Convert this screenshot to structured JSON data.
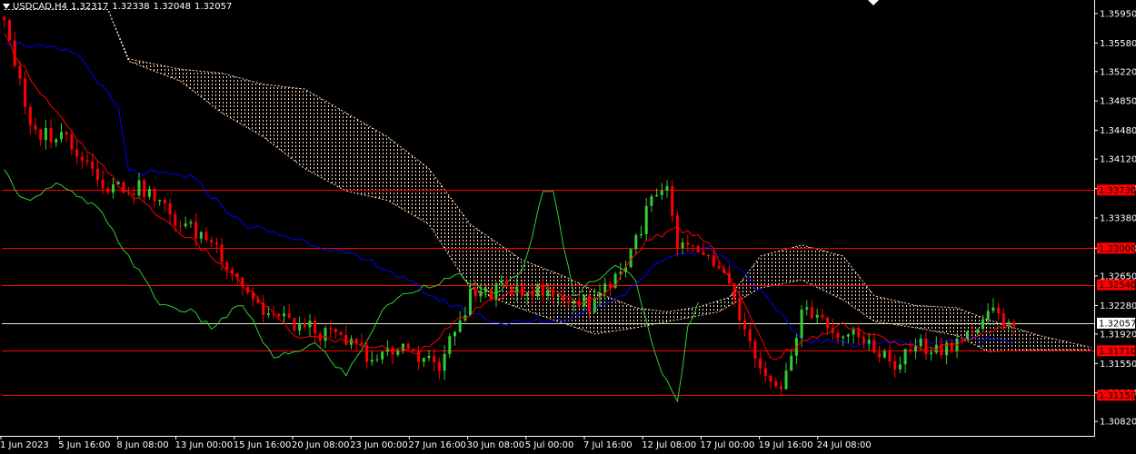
{
  "header": {
    "symbol": "USDCAD,H4",
    "open": "1.32317",
    "high": "1.32338",
    "low": "1.32048",
    "close": "1.32057"
  },
  "colors": {
    "background": "#000000",
    "axis": "#ffffff",
    "bull": "#32cd32",
    "bear": "#ff0000",
    "tenkan": "#ff0000",
    "kijun": "#0000ff",
    "chikou": "#32cd32",
    "cloud": "#ffdab9",
    "hline": "#ff0000",
    "current_price_line": "#e8e8d0"
  },
  "chart_data": {
    "type": "candlestick",
    "symbol": "USDCAD",
    "timeframe": "H4",
    "ylim": [
      1.3064,
      1.3612
    ],
    "y_ticks": [
      "1.35950",
      "1.35580",
      "1.35220",
      "1.34850",
      "1.34480",
      "1.34120",
      "1.33750",
      "1.33380",
      "1.33000",
      "1.32650",
      "1.32280",
      "1.31920",
      "1.31550",
      "1.31180",
      "1.30820"
    ],
    "x_ticks": [
      "1 Jun 2023",
      "5 Jun 16:00",
      "8 Jun 08:00",
      "13 Jun 00:00",
      "15 Jun 16:00",
      "20 Jun 08:00",
      "23 Jun 00:00",
      "27 Jun 16:00",
      "30 Jun 08:00",
      "5 Jul 00:00",
      "7 Jul 16:00",
      "12 Jul 08:00",
      "17 Jul 00:00",
      "19 Jul 16:00",
      "24 Jul 08:00"
    ],
    "horizontal_levels": [
      {
        "label": "1.33730",
        "value": 1.3373
      },
      {
        "label": "1.33000",
        "value": 1.33
      },
      {
        "label": "1.32540",
        "value": 1.3254
      },
      {
        "label": "1.31710",
        "value": 1.3171
      },
      {
        "label": "1.31150",
        "value": 1.3115
      }
    ],
    "current_price": {
      "label": "1.32057",
      "value": 1.32057
    },
    "close_path": [
      [
        0,
        1.3592
      ],
      [
        5,
        1.3446
      ],
      [
        12,
        1.344
      ],
      [
        20,
        1.3378
      ],
      [
        27,
        1.3374
      ],
      [
        34,
        1.333
      ],
      [
        40,
        1.331
      ],
      [
        50,
        1.322
      ],
      [
        58,
        1.32
      ],
      [
        66,
        1.3182
      ],
      [
        72,
        1.316
      ],
      [
        78,
        1.3176
      ],
      [
        84,
        1.315
      ],
      [
        90,
        1.324
      ],
      [
        99,
        1.3252
      ],
      [
        106,
        1.324
      ],
      [
        113,
        1.323
      ],
      [
        120,
        1.328
      ],
      [
        125,
        1.336
      ],
      [
        128,
        1.3372
      ],
      [
        130,
        1.3298
      ],
      [
        135,
        1.3294
      ],
      [
        140,
        1.325
      ],
      [
        146,
        1.314
      ],
      [
        150,
        1.3112
      ],
      [
        154,
        1.3226
      ],
      [
        160,
        1.3196
      ],
      [
        167,
        1.3182
      ],
      [
        172,
        1.315
      ],
      [
        176,
        1.318
      ],
      [
        180,
        1.3172
      ],
      [
        186,
        1.319
      ],
      [
        191,
        1.3218
      ],
      [
        195,
        1.32057
      ]
    ],
    "tenkan_path": [
      [
        0,
        1.3566
      ],
      [
        6,
        1.3505
      ],
      [
        14,
        1.3436
      ],
      [
        22,
        1.338
      ],
      [
        30,
        1.334
      ],
      [
        40,
        1.329
      ],
      [
        50,
        1.323
      ],
      [
        56,
        1.319
      ],
      [
        64,
        1.3185
      ],
      [
        72,
        1.3175
      ],
      [
        80,
        1.317
      ],
      [
        88,
        1.321
      ],
      [
        96,
        1.324
      ],
      [
        104,
        1.325
      ],
      [
        112,
        1.323
      ],
      [
        118,
        1.3255
      ],
      [
        124,
        1.331
      ],
      [
        130,
        1.3325
      ],
      [
        136,
        1.331
      ],
      [
        142,
        1.324
      ],
      [
        148,
        1.316
      ],
      [
        154,
        1.318
      ],
      [
        162,
        1.3205
      ],
      [
        170,
        1.3185
      ],
      [
        178,
        1.3172
      ],
      [
        186,
        1.3185
      ],
      [
        195,
        1.3205
      ]
    ],
    "kijun_path": [
      [
        0,
        1.356
      ],
      [
        14,
        1.3545
      ],
      [
        22,
        1.3475
      ],
      [
        24,
        1.3396
      ],
      [
        36,
        1.339
      ],
      [
        46,
        1.333
      ],
      [
        60,
        1.3305
      ],
      [
        72,
        1.328
      ],
      [
        84,
        1.3235
      ],
      [
        96,
        1.3205
      ],
      [
        108,
        1.321
      ],
      [
        114,
        1.3225
      ],
      [
        120,
        1.3245
      ],
      [
        128,
        1.329
      ],
      [
        136,
        1.33
      ],
      [
        142,
        1.3275
      ],
      [
        148,
        1.323
      ],
      [
        154,
        1.3185
      ],
      [
        164,
        1.318
      ],
      [
        176,
        1.3182
      ],
      [
        186,
        1.3185
      ],
      [
        195,
        1.3186
      ]
    ],
    "chikou_path": [
      [
        0,
        1.3395
      ],
      [
        4,
        1.336
      ],
      [
        10,
        1.338
      ],
      [
        18,
        1.335
      ],
      [
        24,
        1.329
      ],
      [
        30,
        1.323
      ],
      [
        36,
        1.322
      ],
      [
        40,
        1.32
      ],
      [
        46,
        1.323
      ],
      [
        52,
        1.316
      ],
      [
        60,
        1.318
      ],
      [
        66,
        1.314
      ],
      [
        74,
        1.323
      ],
      [
        80,
        1.325
      ],
      [
        88,
        1.3265
      ],
      [
        94,
        1.324
      ],
      [
        100,
        1.327
      ],
      [
        104,
        1.3368
      ],
      [
        106,
        1.337
      ],
      [
        110,
        1.324
      ],
      [
        114,
        1.326
      ],
      [
        118,
        1.328
      ],
      [
        122,
        1.3258
      ],
      [
        126,
        1.316
      ],
      [
        130,
        1.3105
      ],
      [
        132,
        1.32
      ],
      [
        134,
        1.323
      ]
    ],
    "cloud_span_a": [
      [
        0,
        1.36
      ],
      [
        20,
        1.36
      ],
      [
        24,
        1.3538
      ],
      [
        34,
        1.3525
      ],
      [
        42,
        1.352
      ],
      [
        50,
        1.3506
      ],
      [
        58,
        1.35
      ],
      [
        66,
        1.347
      ],
      [
        74,
        1.344
      ],
      [
        82,
        1.34
      ],
      [
        90,
        1.333
      ],
      [
        100,
        1.3285
      ],
      [
        108,
        1.3265
      ],
      [
        116,
        1.324
      ],
      [
        122,
        1.3225
      ],
      [
        128,
        1.322
      ],
      [
        134,
        1.3226
      ],
      [
        140,
        1.3238
      ],
      [
        146,
        1.329
      ],
      [
        154,
        1.3304
      ],
      [
        162,
        1.329
      ],
      [
        168,
        1.324
      ],
      [
        176,
        1.3228
      ],
      [
        184,
        1.3225
      ],
      [
        190,
        1.321
      ],
      [
        200,
        1.319
      ],
      [
        210,
        1.3175
      ]
    ],
    "cloud_span_b": [
      [
        0,
        1.36
      ],
      [
        20,
        1.36
      ],
      [
        24,
        1.3535
      ],
      [
        34,
        1.351
      ],
      [
        42,
        1.347
      ],
      [
        50,
        1.344
      ],
      [
        58,
        1.34
      ],
      [
        66,
        1.3372
      ],
      [
        74,
        1.336
      ],
      [
        82,
        1.333
      ],
      [
        90,
        1.325
      ],
      [
        98,
        1.3228
      ],
      [
        106,
        1.321
      ],
      [
        114,
        1.3192
      ],
      [
        122,
        1.32
      ],
      [
        130,
        1.321
      ],
      [
        138,
        1.322
      ],
      [
        146,
        1.325
      ],
      [
        154,
        1.326
      ],
      [
        162,
        1.3235
      ],
      [
        168,
        1.3208
      ],
      [
        176,
        1.32
      ],
      [
        184,
        1.319
      ],
      [
        190,
        1.317
      ],
      [
        200,
        1.3172
      ],
      [
        210,
        1.3172
      ]
    ]
  }
}
